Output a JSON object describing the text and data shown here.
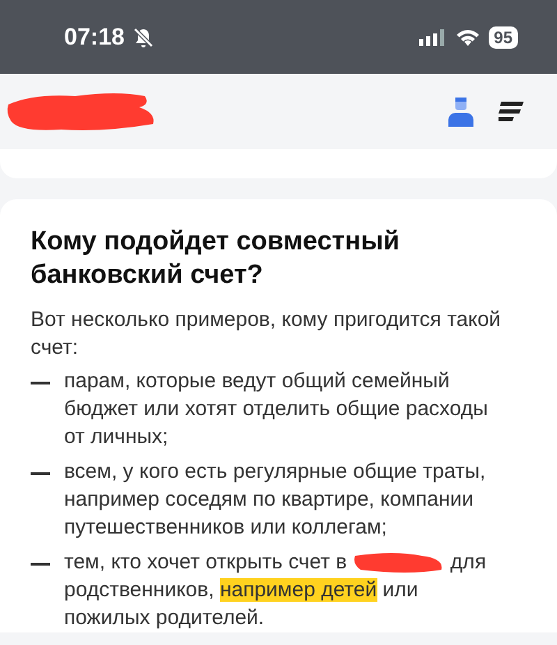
{
  "status_bar": {
    "time": "07:18",
    "silent": true,
    "battery": "95"
  },
  "article": {
    "title": "Кому подойдет совместный банковский счет?",
    "intro": "Вот несколько примеров, кому пригодится такой счет:",
    "items": [
      {
        "parts": [
          {
            "text": "парам, которые ведут общий семейный бюджет или хотят отделить общие расходы от личных;",
            "highlighted": false
          }
        ]
      },
      {
        "parts": [
          {
            "text": "всем, у кого есть регулярные общие траты, например соседям по квартире, компании путешественников или коллегам;",
            "highlighted": false
          }
        ]
      },
      {
        "parts": [
          {
            "text": "тем, кто хочет открыть счет в ",
            "highlighted": false
          },
          {
            "kind": "redacted"
          },
          {
            "text": " для родственников, ",
            "highlighted": false
          },
          {
            "text": "например детей",
            "highlighted": true
          },
          {
            "text": " или пожилых родителей.",
            "highlighted": false
          }
        ]
      }
    ]
  }
}
